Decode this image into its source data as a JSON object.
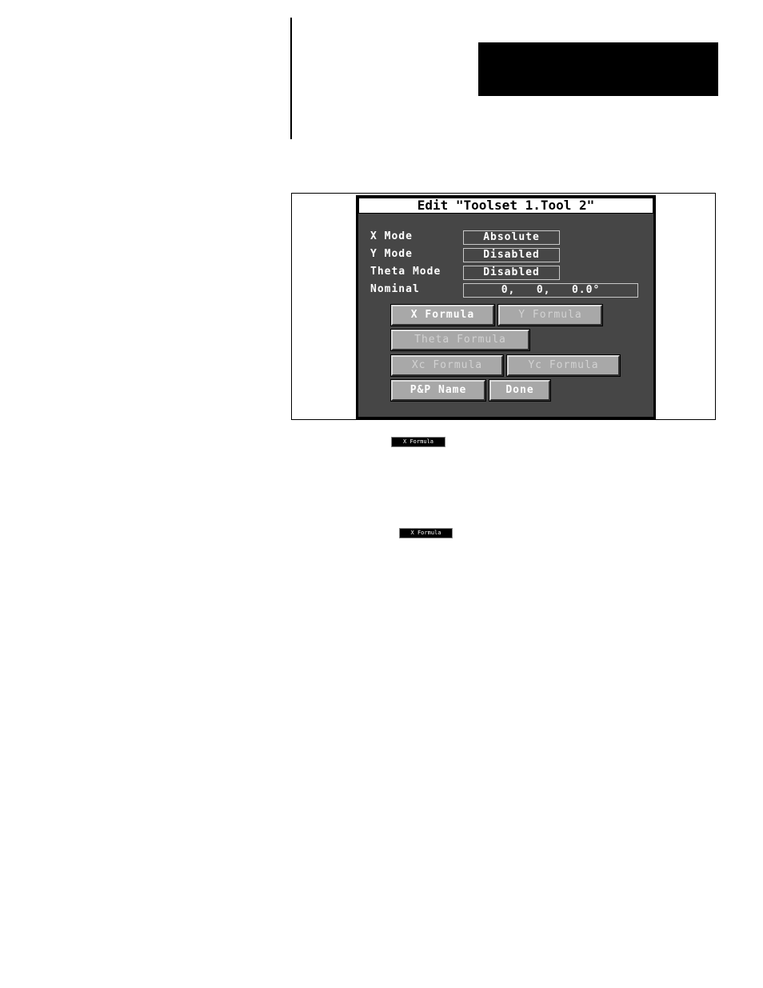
{
  "dialog": {
    "title": "Edit \"Toolset 1.Tool 2\"",
    "fields": [
      {
        "label": "X Mode",
        "value": "Absolute"
      },
      {
        "label": "Y Mode",
        "value": "Disabled"
      },
      {
        "label": "Theta Mode",
        "value": "Disabled"
      },
      {
        "label": "Nominal",
        "value": "0,   0,   0.0°"
      }
    ],
    "buttons": {
      "x_formula": "X Formula",
      "y_formula": "Y Formula",
      "theta_formula": "Theta Formula",
      "xc_formula": "Xc Formula",
      "yc_formula": "Yc Formula",
      "pp_name": "P&P Name",
      "done": "Done"
    }
  },
  "inline_icons": {
    "x_formula_1": "X Formula",
    "x_formula_2": "X Formula"
  },
  "colors": {
    "dialog_bg": "#464646",
    "button_face": "#a8a8a8"
  }
}
